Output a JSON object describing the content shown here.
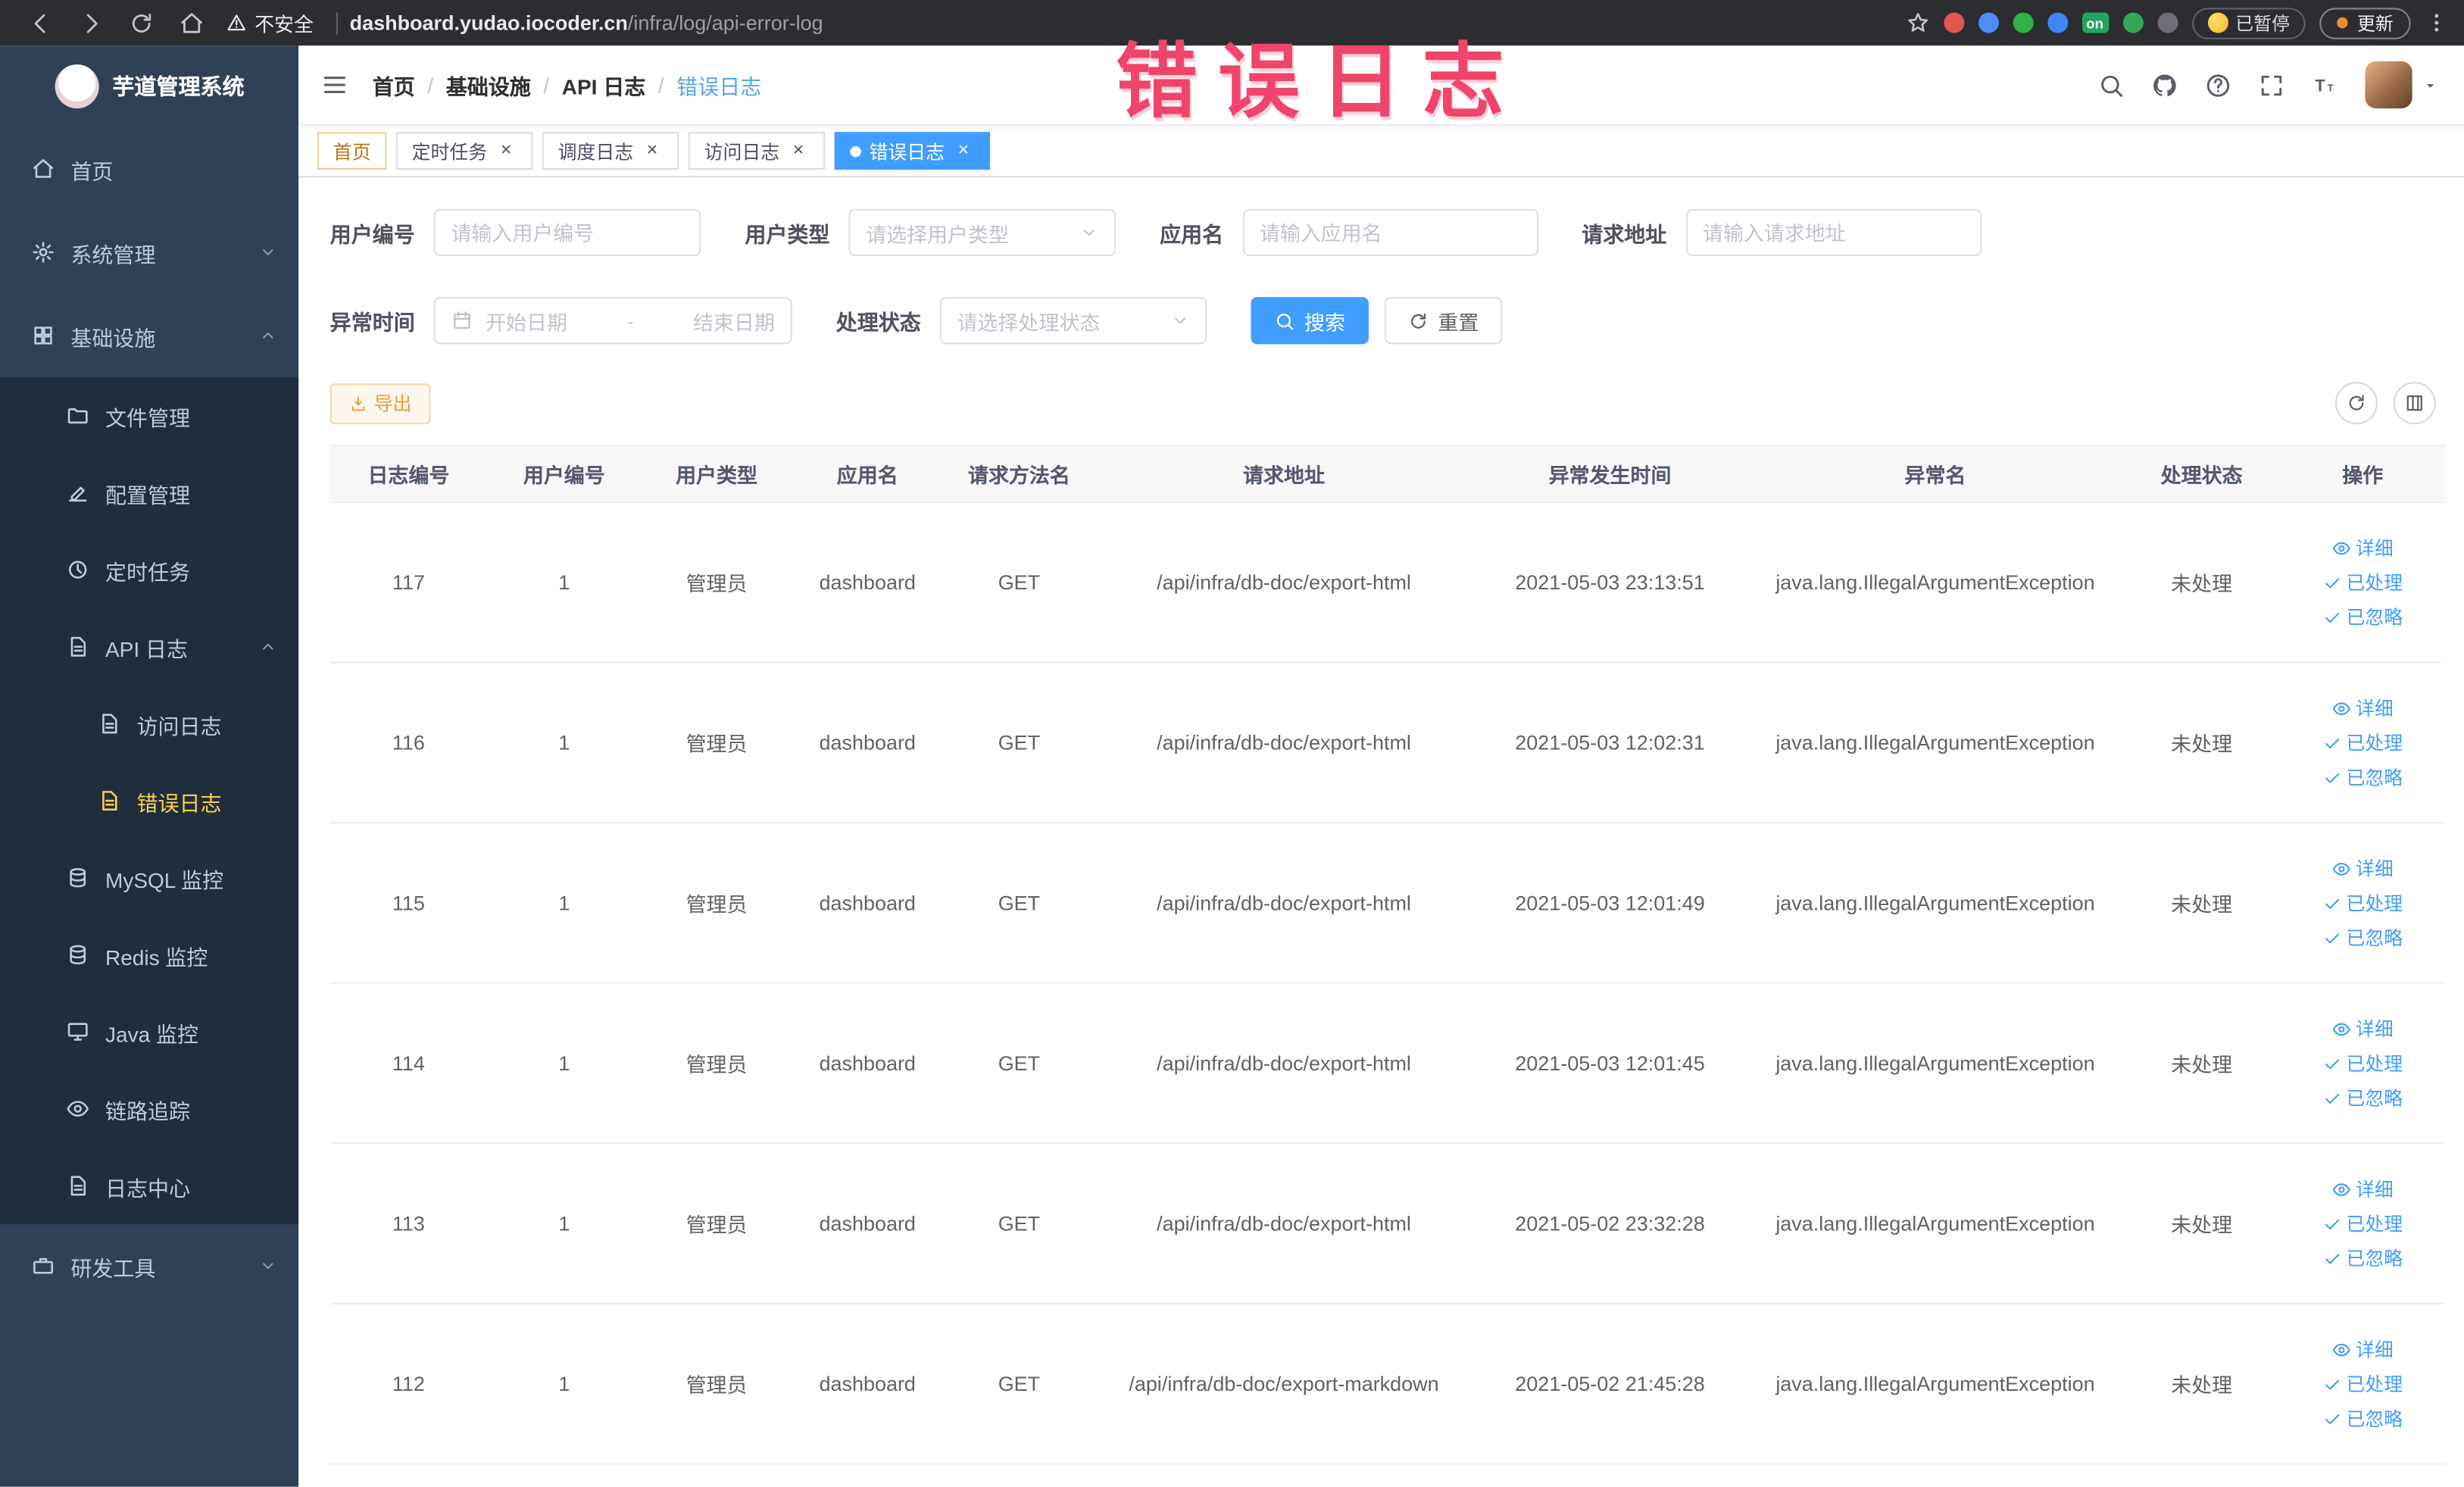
{
  "browser": {
    "security_label": "不安全",
    "url": {
      "domain": "dashboard.yudao.iocoder.cn",
      "path": "/infra/log/api-error-log"
    },
    "paused_badge": "已暂停",
    "update_label": "更新",
    "extensions": [
      {
        "key": "extension-red-circle",
        "color": "#e2574c"
      },
      {
        "key": "extension-blue-drop",
        "color": "#4e8cf9"
      },
      {
        "key": "extension-green-circle",
        "color": "#2fb344"
      },
      {
        "key": "extension-blue-grid",
        "color": "#4285f4"
      },
      {
        "key": "extension-on-badge",
        "color": "#23a55a",
        "text": "on"
      },
      {
        "key": "extension-green-leaf",
        "color": "#34a853"
      },
      {
        "key": "extension-dark-star",
        "color": "#6b6f76"
      }
    ]
  },
  "annotation": {
    "text": "错误日志",
    "color": "#f0456b"
  },
  "sidebar": {
    "logo_title": "芋道管理系统",
    "items": [
      {
        "key": "home",
        "label": "首页",
        "icon": "home",
        "level": 0
      },
      {
        "key": "system-mgmt",
        "label": "系统管理",
        "icon": "gear",
        "level": 0,
        "chevron": "down"
      },
      {
        "key": "infrastructure",
        "label": "基础设施",
        "icon": "grid",
        "level": 0,
        "chevron": "up"
      },
      {
        "key": "file-mgmt",
        "label": "文件管理",
        "icon": "folder",
        "level": 1
      },
      {
        "key": "config-mgmt",
        "label": "配置管理",
        "icon": "edit",
        "level": 1
      },
      {
        "key": "cron-job",
        "label": "定时任务",
        "icon": "clock",
        "level": 1
      },
      {
        "key": "api-log",
        "label": "API 日志",
        "icon": "doc",
        "level": 1,
        "chevron": "up"
      },
      {
        "key": "access-log",
        "label": "访问日志",
        "icon": "doc",
        "level": 2
      },
      {
        "key": "error-log",
        "label": "错误日志",
        "icon": "doc",
        "level": 2,
        "active": true
      },
      {
        "key": "mysql-monitor",
        "label": "MySQL 监控",
        "icon": "db",
        "level": 1
      },
      {
        "key": "redis-monitor",
        "label": "Redis 监控",
        "icon": "db",
        "level": 1
      },
      {
        "key": "java-monitor",
        "label": "Java 监控",
        "icon": "monitor",
        "level": 1
      },
      {
        "key": "tracing",
        "label": "链路追踪",
        "icon": "eye",
        "level": 1
      },
      {
        "key": "log-center",
        "label": "日志中心",
        "icon": "doc",
        "level": 1
      },
      {
        "key": "dev-tools",
        "label": "研发工具",
        "icon": "tool",
        "level": 0,
        "chevron": "down"
      }
    ]
  },
  "header": {
    "breadcrumb": [
      "首页",
      "基础设施",
      "API 日志",
      "错误日志"
    ]
  },
  "tabs": [
    {
      "key": "home",
      "label": "首页",
      "closable": false,
      "active": false
    },
    {
      "key": "cron-job",
      "label": "定时任务",
      "closable": true,
      "active": false
    },
    {
      "key": "job-log",
      "label": "调度日志",
      "closable": true,
      "active": false
    },
    {
      "key": "access-log",
      "label": "访问日志",
      "closable": true,
      "active": false
    },
    {
      "key": "error-log",
      "label": "错误日志",
      "closable": true,
      "active": true
    }
  ],
  "filters": {
    "user_id": {
      "label": "用户编号",
      "placeholder": "请输入用户编号"
    },
    "user_type": {
      "label": "用户类型",
      "placeholder": "请选择用户类型"
    },
    "app_name": {
      "label": "应用名",
      "placeholder": "请输入应用名"
    },
    "request_url": {
      "label": "请求地址",
      "placeholder": "请输入请求地址"
    },
    "exception_time": {
      "label": "异常时间",
      "start_placeholder": "开始日期",
      "separator": "-",
      "end_placeholder": "结束日期"
    },
    "process_status": {
      "label": "处理状态",
      "placeholder": "请选择处理状态"
    },
    "search_button": "搜索",
    "reset_button": "重置"
  },
  "toolbar": {
    "export_button": "导出"
  },
  "table": {
    "columns": [
      "日志编号",
      "用户编号",
      "用户类型",
      "应用名",
      "请求方法名",
      "请求地址",
      "异常发生时间",
      "异常名",
      "处理状态",
      "操作"
    ],
    "action_labels": [
      "详细",
      "已处理",
      "已忽略"
    ],
    "rows": [
      {
        "id": "117",
        "user_id": "1",
        "user_type": "管理员",
        "app_name": "dashboard",
        "method": "GET",
        "url": "/api/infra/db-doc/export-html",
        "time": "2021-05-03 23:13:51",
        "exception": "java.lang.IllegalArgumentException",
        "status": "未处理"
      },
      {
        "id": "116",
        "user_id": "1",
        "user_type": "管理员",
        "app_name": "dashboard",
        "method": "GET",
        "url": "/api/infra/db-doc/export-html",
        "time": "2021-05-03 12:02:31",
        "exception": "java.lang.IllegalArgumentException",
        "status": "未处理"
      },
      {
        "id": "115",
        "user_id": "1",
        "user_type": "管理员",
        "app_name": "dashboard",
        "method": "GET",
        "url": "/api/infra/db-doc/export-html",
        "time": "2021-05-03 12:01:49",
        "exception": "java.lang.IllegalArgumentException",
        "status": "未处理"
      },
      {
        "id": "114",
        "user_id": "1",
        "user_type": "管理员",
        "app_name": "dashboard",
        "method": "GET",
        "url": "/api/infra/db-doc/export-html",
        "time": "2021-05-03 12:01:45",
        "exception": "java.lang.IllegalArgumentException",
        "status": "未处理"
      },
      {
        "id": "113",
        "user_id": "1",
        "user_type": "管理员",
        "app_name": "dashboard",
        "method": "GET",
        "url": "/api/infra/db-doc/export-html",
        "time": "2021-05-02 23:32:28",
        "exception": "java.lang.IllegalArgumentException",
        "status": "未处理"
      },
      {
        "id": "112",
        "user_id": "1",
        "user_type": "管理员",
        "app_name": "dashboard",
        "method": "GET",
        "url": "/api/infra/db-doc/export-markdown",
        "time": "2021-05-02 21:45:28",
        "exception": "java.lang.IllegalArgumentException",
        "status": "未处理"
      }
    ]
  },
  "colors": {
    "accent": "#409eff",
    "sidebar_active": "#ffd04b",
    "warning": "#e6a23c",
    "annotation": "#f0456b"
  }
}
